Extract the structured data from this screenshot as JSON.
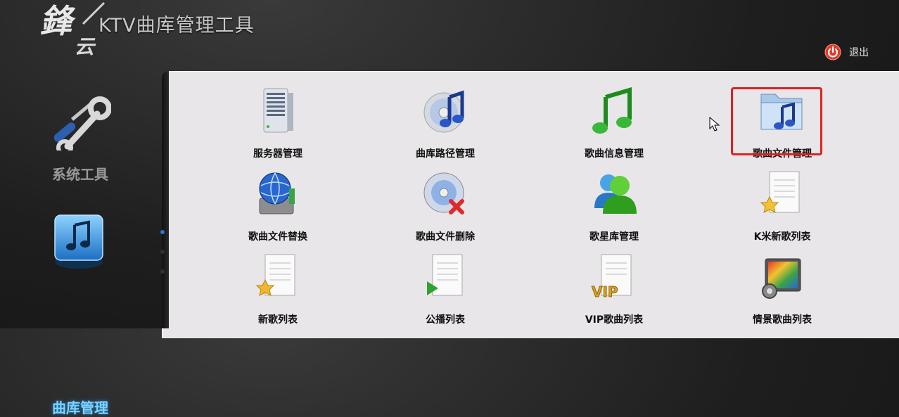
{
  "app": {
    "title": "KTV曲库管理工具",
    "logo_text": "鋒云"
  },
  "header": {
    "exit_label": "退出"
  },
  "sidebar": {
    "items": [
      {
        "label": "系统工具",
        "icon": "wrench-screwdriver-icon",
        "active": false
      },
      {
        "label": "曲库管理",
        "icon": "music-note-icon",
        "active": true
      }
    ]
  },
  "grid": {
    "items": [
      {
        "label": "服务器管理",
        "icon": "server-icon"
      },
      {
        "label": "曲库路径管理",
        "icon": "music-disc-icon"
      },
      {
        "label": "歌曲信息管理",
        "icon": "green-note-icon"
      },
      {
        "label": "歌曲文件管理",
        "icon": "music-folder-icon"
      },
      {
        "label": "歌曲文件替换",
        "icon": "globe-drive-icon"
      },
      {
        "label": "歌曲文件删除",
        "icon": "disc-delete-icon"
      },
      {
        "label": "歌星库管理",
        "icon": "users-icon"
      },
      {
        "label": "K米新歌列表",
        "icon": "doc-badge-icon"
      },
      {
        "label": "新歌列表",
        "icon": "doc-star-icon"
      },
      {
        "label": "公播列表",
        "icon": "doc-play-icon"
      },
      {
        "label": "VIP歌曲列表",
        "icon": "doc-vip-icon"
      },
      {
        "label": "情景歌曲列表",
        "icon": "scene-settings-icon"
      }
    ]
  },
  "colors": {
    "accent": "#7fd2ff",
    "highlight": "#e02020",
    "panel": "#e8e6e8"
  }
}
